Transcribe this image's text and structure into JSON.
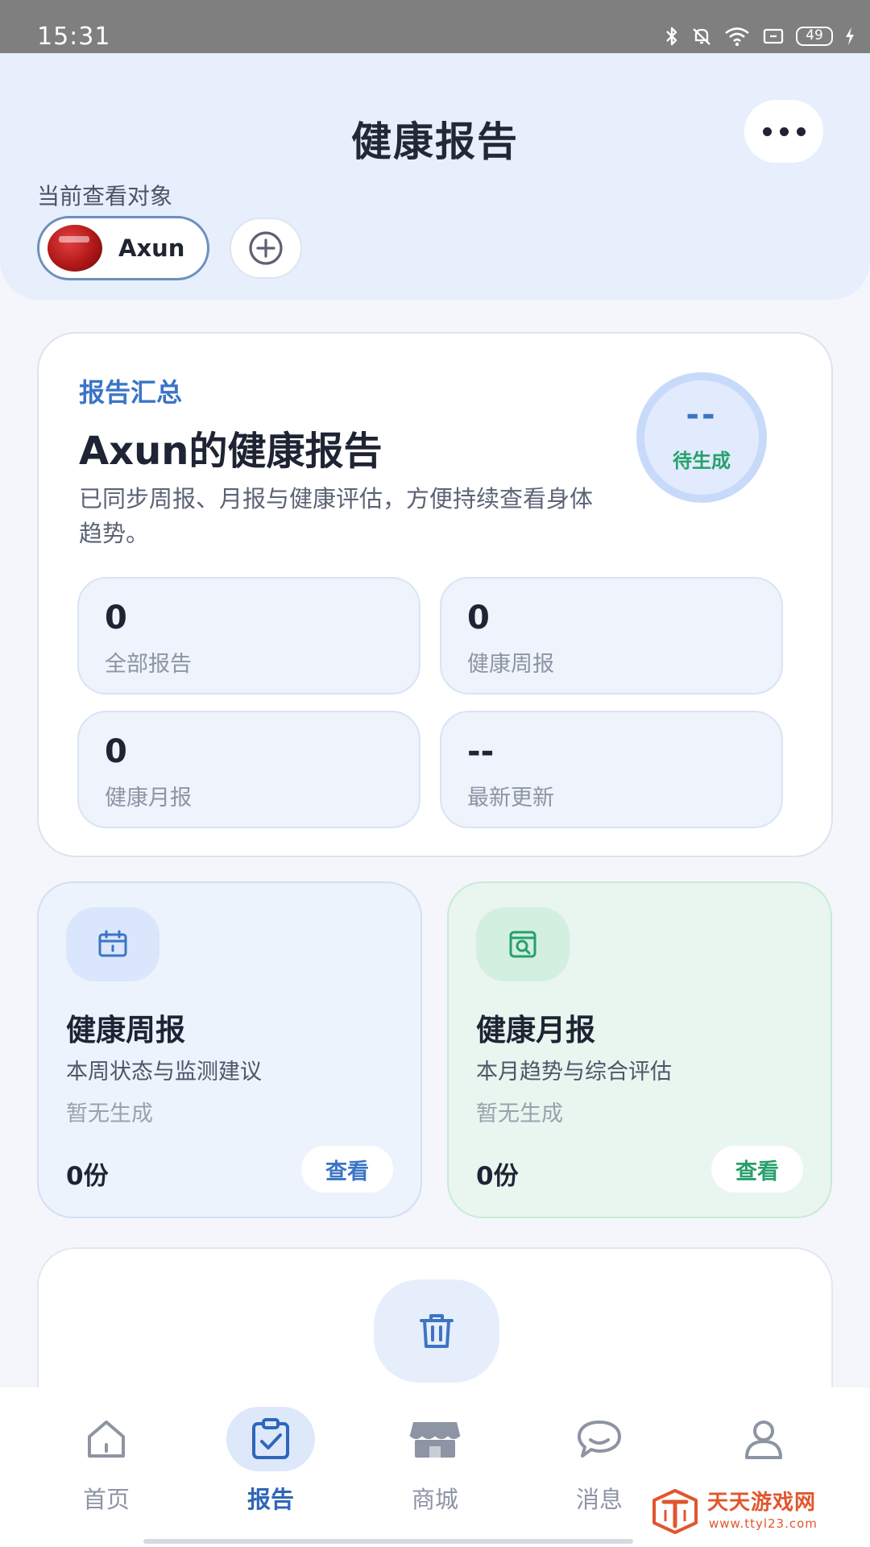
{
  "status_bar": {
    "time": "15:31",
    "battery": "49"
  },
  "header": {
    "title": "健康报告",
    "viewing_label": "当前查看对象",
    "profile_name": "Axun"
  },
  "summary": {
    "label": "报告汇总",
    "title": "Axun的健康报告",
    "description": "已同步周报、月报与健康评估，方便持续查看身体趋势。",
    "score_value": "--",
    "score_status": "待生成",
    "stats": [
      {
        "value": "0",
        "label": "全部报告"
      },
      {
        "value": "0",
        "label": "健康周报"
      },
      {
        "value": "0",
        "label": "健康月报"
      },
      {
        "value": "--",
        "label": "最新更新"
      }
    ]
  },
  "reports": {
    "weekly": {
      "title": "健康周报",
      "subtitle": "本周状态与监测建议",
      "status": "暂无生成",
      "count": "0份",
      "action": "查看"
    },
    "monthly": {
      "title": "健康月报",
      "subtitle": "本月趋势与综合评估",
      "status": "暂无生成",
      "count": "0份",
      "action": "查看"
    }
  },
  "tabs": [
    {
      "label": "首页",
      "icon": "home-icon"
    },
    {
      "label": "报告",
      "icon": "report-icon",
      "active": true
    },
    {
      "label": "商城",
      "icon": "store-icon"
    },
    {
      "label": "消息",
      "icon": "message-icon"
    },
    {
      "label": "",
      "icon": "profile-icon"
    }
  ],
  "watermark": {
    "text": "天天游戏网",
    "url": "www.ttyl23.com"
  },
  "colors": {
    "accent": "#3b74c6",
    "success": "#27a06c",
    "header_bg": "#e7effd"
  }
}
